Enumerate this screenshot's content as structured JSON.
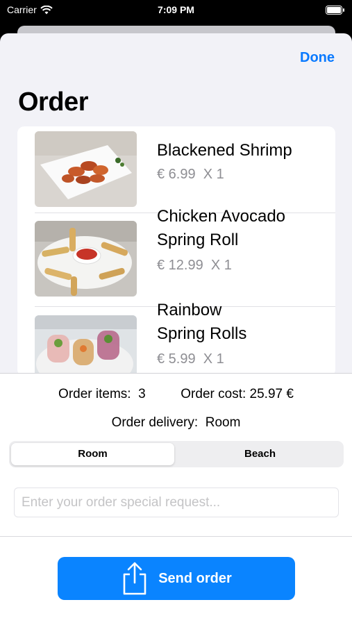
{
  "status_bar": {
    "carrier": "Carrier",
    "time": "7:09 PM"
  },
  "header": {
    "done_label": "Done",
    "title": "Order"
  },
  "order_items": [
    {
      "name": "Blackened Shrimp",
      "price": "€ 6.99",
      "quantity": "X 1",
      "image": "shrimp-photo"
    },
    {
      "name": "Chicken Avocado\nSpring Roll",
      "price": "€ 12.99",
      "quantity": "X 1",
      "image": "spring-roll-photo"
    },
    {
      "name": "Rainbow\nSpring Rolls",
      "price": "€ 5.99",
      "quantity": "X 1",
      "image": "rainbow-rolls-photo"
    }
  ],
  "summary": {
    "items_label": "Order items:",
    "items_value": "3",
    "cost_label": "Order cost:",
    "cost_value": "25.97 €",
    "delivery_label": "Order delivery:",
    "delivery_value": "Room"
  },
  "delivery_segments": {
    "options": [
      "Room",
      "Beach"
    ],
    "selected": "Room"
  },
  "request": {
    "placeholder": "Enter your order special request...",
    "value": ""
  },
  "send_button": {
    "label": "Send order",
    "icon": "share-icon"
  },
  "colors": {
    "accent": "#0a84ff",
    "done": "#0a7aff",
    "price": "#8e8e93"
  }
}
